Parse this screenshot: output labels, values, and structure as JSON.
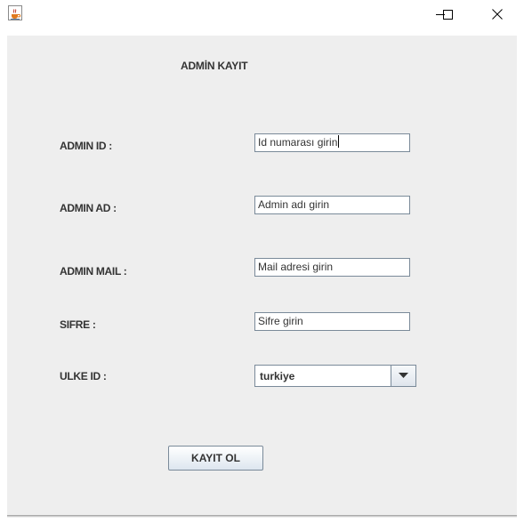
{
  "window": {
    "app_icon": "java-cup-icon",
    "controls": {
      "minimize_icon": "minimize-icon",
      "maximize_icon": "maximize-icon",
      "close_icon": "close-icon"
    }
  },
  "form": {
    "title": "ADMİN KAYIT",
    "fields": {
      "admin_id": {
        "label": "ADMIN ID :",
        "value": "Id numarası girin"
      },
      "admin_ad": {
        "label": "ADMIN AD :",
        "value": "Admin adı girin"
      },
      "admin_mail": {
        "label": "ADMIN MAIL :",
        "value": "Mail adresi girin"
      },
      "sifre": {
        "label": "SIFRE :",
        "value": "Sifre girin"
      },
      "ulke_id": {
        "label": "ULKE ID :",
        "selected": "turkiye",
        "arrow_icon": "dropdown-arrow-icon"
      }
    },
    "submit_label": "KAYIT OL"
  },
  "colors": {
    "panel_background": "#eeeeee",
    "field_border": "#7a8a99",
    "label_text": "#333333"
  }
}
